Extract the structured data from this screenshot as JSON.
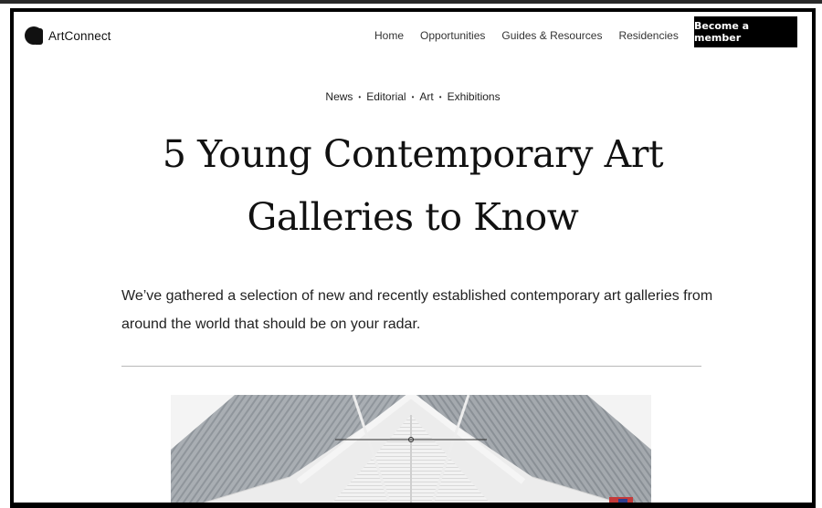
{
  "brand": {
    "name": "ArtConnect"
  },
  "nav": {
    "items": [
      "Home",
      "Opportunities",
      "Guides & Resources",
      "Residencies"
    ],
    "instagram_icon": "instagram-icon",
    "cta_label": "Become a member"
  },
  "article": {
    "categories": [
      "News",
      "Editorial",
      "Art",
      "Exhibitions"
    ],
    "separator": "•",
    "title_line1": "5 Young Contemporary Art",
    "title_line2": "Galleries to Know",
    "lede": "We’ve gathered a selection of new and recently established contemporary art galleries from around the world that should be on your radar."
  },
  "colors": {
    "accent": "#000000",
    "text": "#111111",
    "rule": "#b8b8b8"
  }
}
